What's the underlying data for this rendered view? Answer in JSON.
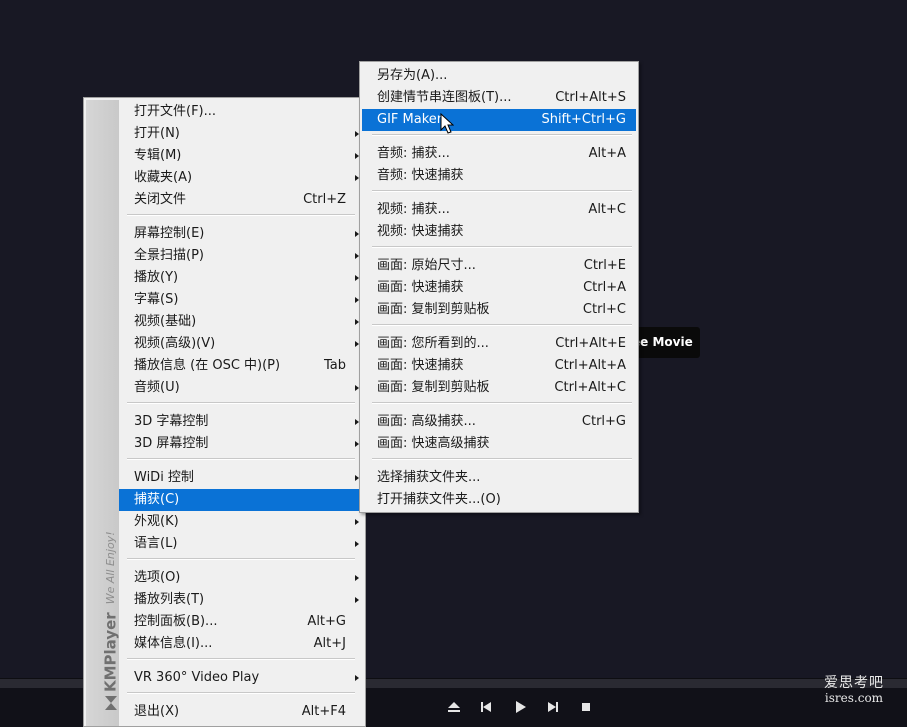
{
  "main_menu": {
    "brand_name": "KMPlayer",
    "brand_tagline": "We All Enjoy!",
    "items": [
      {
        "label": "打开文件(F)...",
        "shortcut": "",
        "submenu": false
      },
      {
        "label": "打开(N)",
        "shortcut": "",
        "submenu": true
      },
      {
        "label": "专辑(M)",
        "shortcut": "",
        "submenu": true
      },
      {
        "label": "收藏夹(A)",
        "shortcut": "",
        "submenu": true
      },
      {
        "label": "关闭文件",
        "shortcut": "Ctrl+Z",
        "submenu": false
      },
      {
        "label": "屏幕控制(E)",
        "shortcut": "",
        "submenu": true
      },
      {
        "label": "全景扫描(P)",
        "shortcut": "",
        "submenu": true
      },
      {
        "label": "播放(Y)",
        "shortcut": "",
        "submenu": true
      },
      {
        "label": "字幕(S)",
        "shortcut": "",
        "submenu": true
      },
      {
        "label": "视频(基础)",
        "shortcut": "",
        "submenu": true
      },
      {
        "label": "视频(高级)(V)",
        "shortcut": "",
        "submenu": true
      },
      {
        "label": "播放信息 (在 OSC 中)(P)",
        "shortcut": "Tab",
        "submenu": false
      },
      {
        "label": "音频(U)",
        "shortcut": "",
        "submenu": true
      },
      {
        "label": "3D 字幕控制",
        "shortcut": "",
        "submenu": true
      },
      {
        "label": "3D 屏幕控制",
        "shortcut": "",
        "submenu": true
      },
      {
        "label": "WiDi 控制",
        "shortcut": "",
        "submenu": true
      },
      {
        "label": "捕获(C)",
        "shortcut": "",
        "submenu": true
      },
      {
        "label": "外观(K)",
        "shortcut": "",
        "submenu": true
      },
      {
        "label": "语言(L)",
        "shortcut": "",
        "submenu": true
      },
      {
        "label": "选项(O)",
        "shortcut": "",
        "submenu": true
      },
      {
        "label": "播放列表(T)",
        "shortcut": "",
        "submenu": true
      },
      {
        "label": "控制面板(B)...",
        "shortcut": "Alt+G",
        "submenu": false
      },
      {
        "label": "媒体信息(I)...",
        "shortcut": "Alt+J",
        "submenu": false
      },
      {
        "label": "VR 360° Video Play",
        "shortcut": "",
        "submenu": true
      },
      {
        "label": "退出(X)",
        "shortcut": "Alt+F4",
        "submenu": false
      }
    ]
  },
  "capture_menu": {
    "items": [
      {
        "label": "另存为(A)...",
        "shortcut": ""
      },
      {
        "label": "创建情节串连图板(T)...",
        "shortcut": "Ctrl+Alt+S"
      },
      {
        "label": "GIF Maker",
        "shortcut": "Shift+Ctrl+G"
      },
      {
        "label": "音频: 捕获...",
        "shortcut": "Alt+A"
      },
      {
        "label": "音频: 快速捕获",
        "shortcut": ""
      },
      {
        "label": "视频: 捕获...",
        "shortcut": "Alt+C"
      },
      {
        "label": "视频: 快速捕获",
        "shortcut": ""
      },
      {
        "label": "画面: 原始尺寸...",
        "shortcut": "Ctrl+E"
      },
      {
        "label": "画面: 快速捕获",
        "shortcut": "Ctrl+A"
      },
      {
        "label": "画面: 复制到剪贴板",
        "shortcut": "Ctrl+C"
      },
      {
        "label": "画面: 您所看到的...",
        "shortcut": "Ctrl+Alt+E"
      },
      {
        "label": "画面: 快速捕获",
        "shortcut": "Ctrl+Alt+A"
      },
      {
        "label": "画面: 复制到剪贴板",
        "shortcut": "Ctrl+Alt+C"
      },
      {
        "label": "画面: 高级捕获...",
        "shortcut": "Ctrl+G"
      },
      {
        "label": "画面: 快速高级捕获",
        "shortcut": ""
      },
      {
        "label": "选择捕获文件夹...",
        "shortcut": ""
      },
      {
        "label": "打开捕获文件夹...(O)",
        "shortcut": ""
      }
    ]
  },
  "overlay": {
    "free_movie_text": "ee Movie"
  },
  "watermark": {
    "cn": "爱思考吧",
    "en": "isres.com"
  },
  "colors": {
    "highlight": "#0a72d6",
    "menu_bg": "#f0f0f0",
    "player_bg": "#181824"
  },
  "controls": [
    "eject-icon",
    "previous-icon",
    "play-icon",
    "next-icon",
    "stop-icon"
  ]
}
